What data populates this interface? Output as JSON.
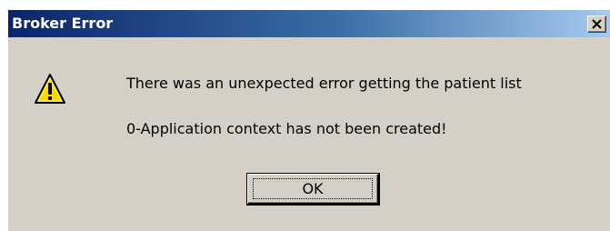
{
  "window": {
    "title": "Broker Error",
    "close_symbol": "×"
  },
  "dialog": {
    "icon": "warning-icon",
    "message_line_1": "There was an unexpected error getting the patient list",
    "message_line_2": "0-Application context has not been created!",
    "ok_label": "OK"
  },
  "colors": {
    "titlebar_start": "#0a246a",
    "titlebar_end": "#a6caf0",
    "dialog_bg": "#d4d0c8",
    "warning_fill": "#ffd800"
  }
}
